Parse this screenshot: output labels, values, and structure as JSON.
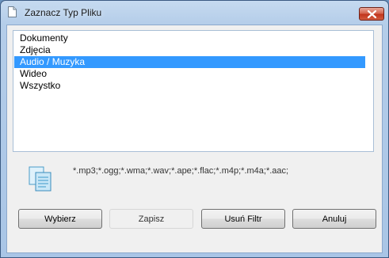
{
  "window": {
    "title": "Zaznacz Typ Pliku",
    "title_icon": "document-icon",
    "close_icon": "close-icon"
  },
  "list": {
    "items": [
      "Dokumenty",
      "Zdjęcia",
      "Audio / Muzyka",
      "Wideo",
      "Wszystko"
    ],
    "selected": "Audio / Muzyka"
  },
  "info": {
    "icon": "documents-icon",
    "extensions": "*.mp3;*.ogg;*.wma;*.wav;*.ape;*.flac;*.m4p;*.m4a;*.aac;"
  },
  "buttons": {
    "select": "Wybierz",
    "save": "Zapisz",
    "remove_filter": "Usuń Filtr",
    "cancel": "Anuluj"
  },
  "colors": {
    "selection": "#3399ff",
    "close_button": "#c2351c"
  }
}
